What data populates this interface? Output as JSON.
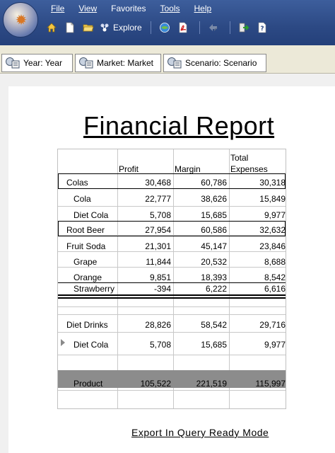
{
  "menu": {
    "file": "File",
    "view": "View",
    "favorites": "Favorites",
    "tools": "Tools",
    "help": "Help"
  },
  "toolbar": {
    "explore_label": "Explore"
  },
  "pov": [
    {
      "label": "Year: Year"
    },
    {
      "label": "Market: Market"
    },
    {
      "label": "Scenario: Scenario"
    }
  ],
  "report": {
    "title": "Financial Report",
    "columns": {
      "profit": "Profit",
      "margin": "Margin",
      "total_line1": "Total",
      "total_line2": "Expenses"
    },
    "rows": [
      {
        "label": "Colas",
        "profit": "30,468",
        "margin": "60,786",
        "total": "30,318"
      },
      {
        "label": "Cola",
        "profit": "22,777",
        "margin": "38,626",
        "total": "15,849"
      },
      {
        "label": "Diet Cola",
        "profit": "5,708",
        "margin": "15,685",
        "total": "9,977"
      },
      {
        "label": "Root Beer",
        "profit": "27,954",
        "margin": "60,586",
        "total": "32,632"
      },
      {
        "label": "Fruit Soda",
        "profit": "21,301",
        "margin": "45,147",
        "total": "23,846"
      },
      {
        "label": "Grape",
        "profit": "11,844",
        "margin": "20,532",
        "total": "8,688"
      },
      {
        "label": "Orange",
        "profit": "9,851",
        "margin": "18,393",
        "total": "8,542"
      },
      {
        "label": "Strawberry",
        "profit": "-394",
        "margin": "6,222",
        "total": "6,616"
      },
      {
        "label": "Diet Drinks",
        "profit": "28,826",
        "margin": "58,542",
        "total": "29,716"
      },
      {
        "label": "Diet Cola",
        "profit": "5,708",
        "margin": "15,685",
        "total": "9,977"
      },
      {
        "label": "Product",
        "profit": "105,522",
        "margin": "221,519",
        "total": "115,997"
      }
    ]
  },
  "export_link": "Export In Query Ready Mode",
  "colors": {
    "header_blue": "#2c4984",
    "pov_bg": "#ece9d8",
    "product_row": "#8c8c8c"
  }
}
